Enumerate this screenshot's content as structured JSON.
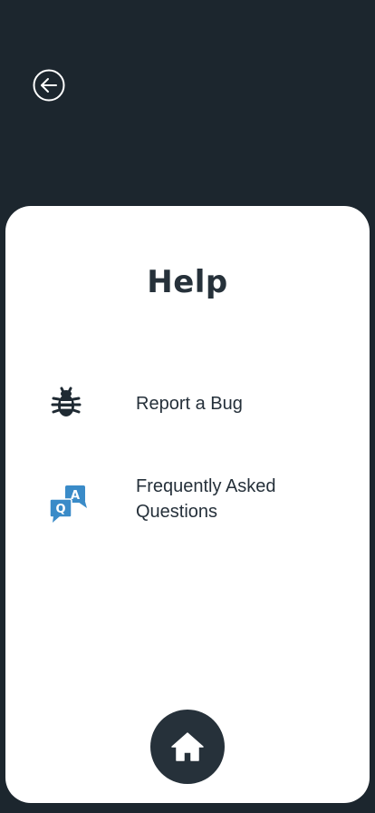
{
  "header": {
    "back_icon": "arrow-left-circle-icon"
  },
  "main": {
    "title": "Help",
    "items": [
      {
        "label": "Report a Bug",
        "icon": "bug-icon"
      },
      {
        "label": "Frequently Asked Questions",
        "icon": "qa-chat-icon"
      }
    ]
  },
  "footer": {
    "home_icon": "home-icon"
  },
  "colors": {
    "background": "#1c262e",
    "card": "#ffffff",
    "text": "#26313a",
    "accent_blue": "#3a8bc8"
  }
}
